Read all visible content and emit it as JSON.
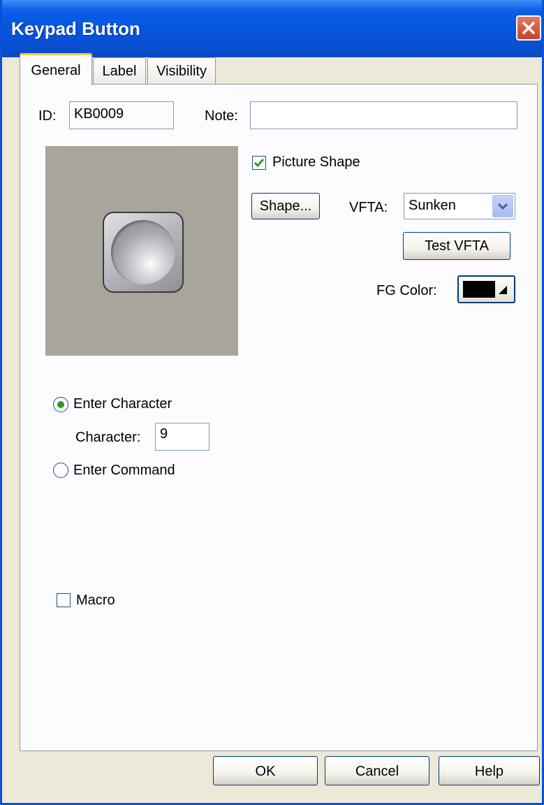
{
  "window": {
    "title": "Keypad Button"
  },
  "tabs": [
    {
      "label": "General",
      "active": true
    },
    {
      "label": "Label",
      "active": false
    },
    {
      "label": "Visibility",
      "active": false
    }
  ],
  "general": {
    "id_label": "ID:",
    "id_value": "KB0009",
    "note_label": "Note:",
    "note_value": "",
    "picture_shape_label": "Picture Shape",
    "picture_shape_checked": true,
    "shape_button": "Shape...",
    "vfta_label": "VFTA:",
    "vfta_value": "Sunken",
    "test_vfta_button": "Test VFTA",
    "fg_color_label": "FG Color:",
    "fg_color": "#000000",
    "enter_character_label": "Enter Character",
    "enter_character_selected": true,
    "character_label": "Character:",
    "character_value": "9",
    "enter_command_label": "Enter Command",
    "macro_label": "Macro",
    "macro_checked": false
  },
  "buttons": {
    "ok": "OK",
    "cancel": "Cancel",
    "help": "Help"
  },
  "icons": {
    "close": "close-icon",
    "checkmark": "checkmark-icon",
    "dropdown": "chevron-down-icon",
    "color_picker_arrow": "triangle-icon"
  }
}
